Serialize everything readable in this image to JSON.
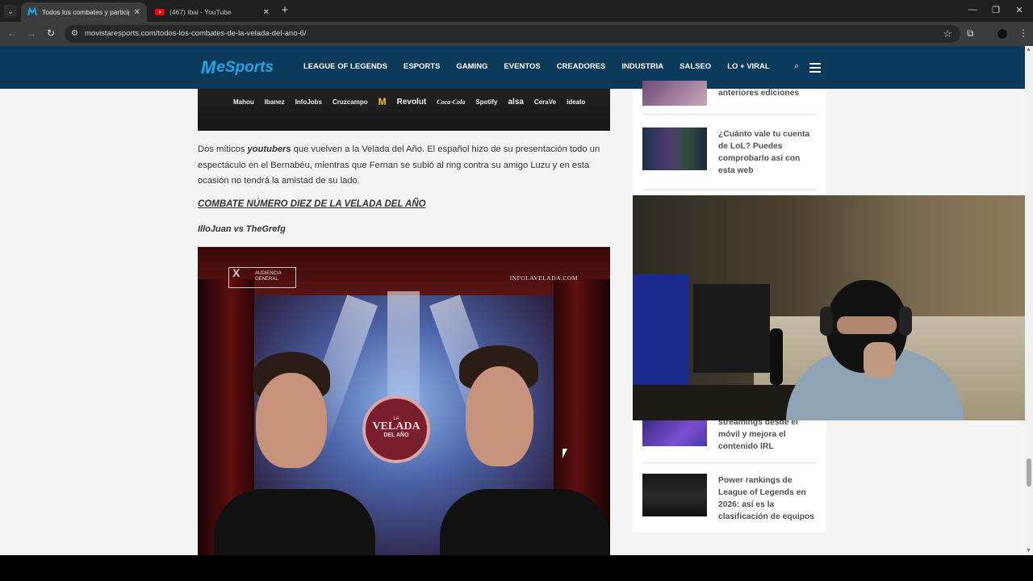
{
  "browser": {
    "tabs": [
      {
        "title": "Todos los combates y participa",
        "favicon": "movistar-m-icon",
        "active": true
      },
      {
        "title": "(467) Ibai - YouTube",
        "favicon": "youtube-icon",
        "active": false
      }
    ],
    "url": "movistaresports.com/todos-los-combates-de-la-velada-del-ano-6/",
    "icons": [
      "tab-search-icon",
      "back-icon",
      "forward-icon",
      "reload-icon",
      "site-info-icon",
      "bookmark-star-icon",
      "extensions-icon",
      "profile-icon",
      "menu-dots-icon",
      "minimize-icon",
      "restore-icon",
      "close-window-icon"
    ]
  },
  "site": {
    "logo": "eSports",
    "nav": [
      "LEAGUE OF LEGENDS",
      "ESPORTS",
      "GAMING",
      "EVENTOS",
      "CREADORES",
      "INDUSTRIA",
      "SALSEO",
      "LO + VIRAL"
    ],
    "brand_color": "#0b3a5c",
    "accent_color": "#1fa6e5"
  },
  "article": {
    "sponsors": [
      "Mahou",
      "Ibanez",
      "InfoJobs",
      "Cruzcampo",
      "M",
      "Revolut",
      "Coca-Cola",
      "Spotify",
      "alsa",
      "CeraVe",
      "idealo"
    ],
    "paragraph_pre": "Dos míticos ",
    "paragraph_em": "youtubers",
    "paragraph_post": " que vuelven a la Velada del Año. El español hizo de su presentación todo un espectáculo en el Bernabéu, mientras que Fernan se subió al ring contra su amigo Luzu y en esta ocasión no tendrá la amistad de su lado.",
    "section_heading": "COMBATE NÚMERO DIEZ DE LA VELADA DEL AÑO",
    "fight": "IlloJuan vs TheGrefg",
    "poster": {
      "badge_x": "X",
      "badge_line1": "AUDIENCIA",
      "badge_line2": "GENERAL",
      "site": "INFOLAVELADA.COM",
      "emblem_small": "LA",
      "emblem_main": "VELADA",
      "emblem_sub": "DEL AÑO"
    }
  },
  "sidebar": {
    "items": [
      {
        "title": "anteriores ediciones"
      },
      {
        "title": "¿Cuánto vale tu cuenta de LoL? Puedes comprobarlo así con esta web"
      },
      {
        "title": "streamings desde el móvil y mejora el contenido IRL"
      },
      {
        "title": "Power rankings de League of Legends en 2026: así es la clasificación de equipos"
      }
    ]
  }
}
